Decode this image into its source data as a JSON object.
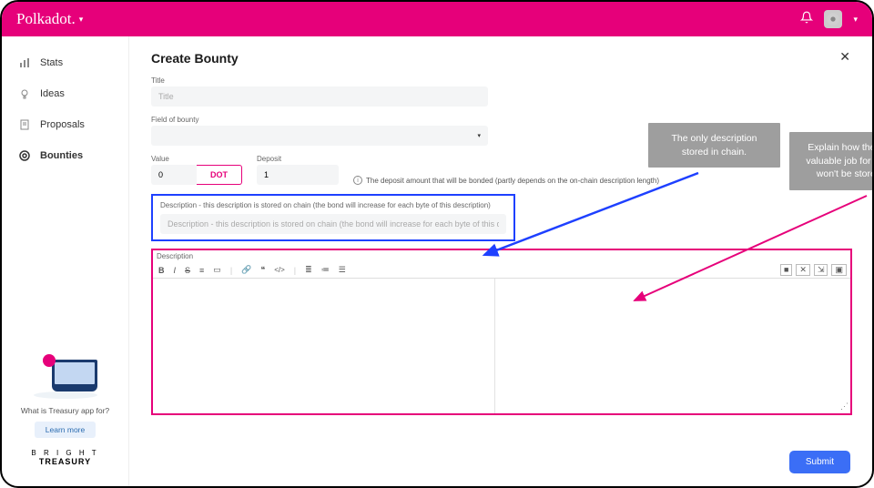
{
  "brand": "Polkadot.",
  "sidebar": {
    "items": [
      {
        "label": "Stats"
      },
      {
        "label": "Ideas"
      },
      {
        "label": "Proposals"
      },
      {
        "label": "Bounties"
      }
    ],
    "promo_text": "What is Treasury app for?",
    "learn_more": "Learn more",
    "bt_line1": "B R I G H T",
    "bt_line2": "TREASURY"
  },
  "page": {
    "title": "Create Bounty",
    "close": "✕"
  },
  "form": {
    "title_label": "Title",
    "title_placeholder": "Title",
    "fob_label": "Field of bounty",
    "value_label": "Value",
    "value": "0",
    "value_unit": "DOT",
    "deposit_label": "Deposit",
    "deposit_value": "1",
    "deposit_note": "The deposit amount that will be bonded (partly depends on the on-chain description length)",
    "onchain_label": "Description - this description is stored on chain (the bond will increase for each byte of this description)",
    "onchain_placeholder": "Description - this description is stored on chain (the bond will increase for each byte of this description)",
    "desc_label": "Description",
    "submit": "Submit"
  },
  "callouts": {
    "c1": "The only description stored in chain.",
    "c2": "Explain how the bounty will be a valuable job for the community. It won't be stored in the chain."
  },
  "toolbar": {
    "b": "B",
    "i": "I",
    "s": "S",
    "line": "≡",
    "img": "▭",
    "link": "🔗",
    "quote": "❝",
    "code": "</>",
    "sep": "|",
    "ul": "≣",
    "ol": "≔",
    "hr": "☰",
    "r1": "■",
    "r2": "✕",
    "r3": "⇲",
    "r4": "▣"
  }
}
